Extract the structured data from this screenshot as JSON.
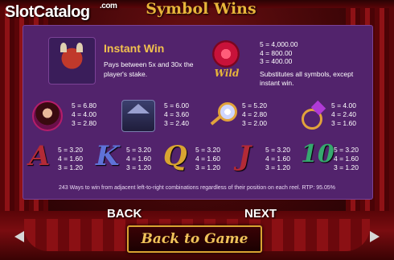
{
  "watermark": {
    "brand": "Slot",
    "brand2": "Catalog",
    "suffix": ".com"
  },
  "title": "Symbol Wins",
  "instant_win": {
    "title": "Instant Win",
    "description": "Pays between 5x and 30x the player's stake."
  },
  "wild": {
    "label": "Wild",
    "pays": [
      "5 = 4,000.00",
      "4 = 800.00",
      "3 = 400.00"
    ],
    "description": "Substitutes all symbols, except instant win."
  },
  "symbols_row1": [
    {
      "icon": "portrait-icon",
      "pays": [
        "5 = 6.80",
        "4 = 4.00",
        "3 = 2.80"
      ]
    },
    {
      "icon": "mansion-icon",
      "pays": [
        "5 = 6.00",
        "4 = 3.60",
        "3 = 2.40"
      ]
    },
    {
      "icon": "mirror-icon",
      "pays": [
        "5 = 5.20",
        "4 = 2.80",
        "3 = 2.00"
      ]
    },
    {
      "icon": "ring-icon",
      "pays": [
        "5 = 4.00",
        "4 = 2.40",
        "3 = 1.60"
      ]
    }
  ],
  "symbols_row2": [
    {
      "glyph": "A",
      "pays": [
        "5 = 3.20",
        "4 = 1.60",
        "3 = 1.20"
      ]
    },
    {
      "glyph": "K",
      "pays": [
        "5 = 3.20",
        "4 = 1.60",
        "3 = 1.20"
      ]
    },
    {
      "glyph": "Q",
      "pays": [
        "5 = 3.20",
        "4 = 1.60",
        "3 = 1.20"
      ]
    },
    {
      "glyph": "J",
      "pays": [
        "5 = 3.20",
        "4 = 1.60",
        "3 = 1.20"
      ]
    },
    {
      "glyph": "10",
      "pays": [
        "5 = 3.20",
        "4 = 1.60",
        "3 = 1.20"
      ]
    }
  ],
  "footnote": "243 Ways to win from adjacent left-to-right combinations regardless of their position on each reel. RTP: 95.05%",
  "nav": {
    "back": "BACK",
    "next": "NEXT",
    "back_to_game": "Back to Game"
  },
  "colors": {
    "panel": "#52236c",
    "gold": "#f2c14e",
    "curtain": "#8e1216"
  }
}
